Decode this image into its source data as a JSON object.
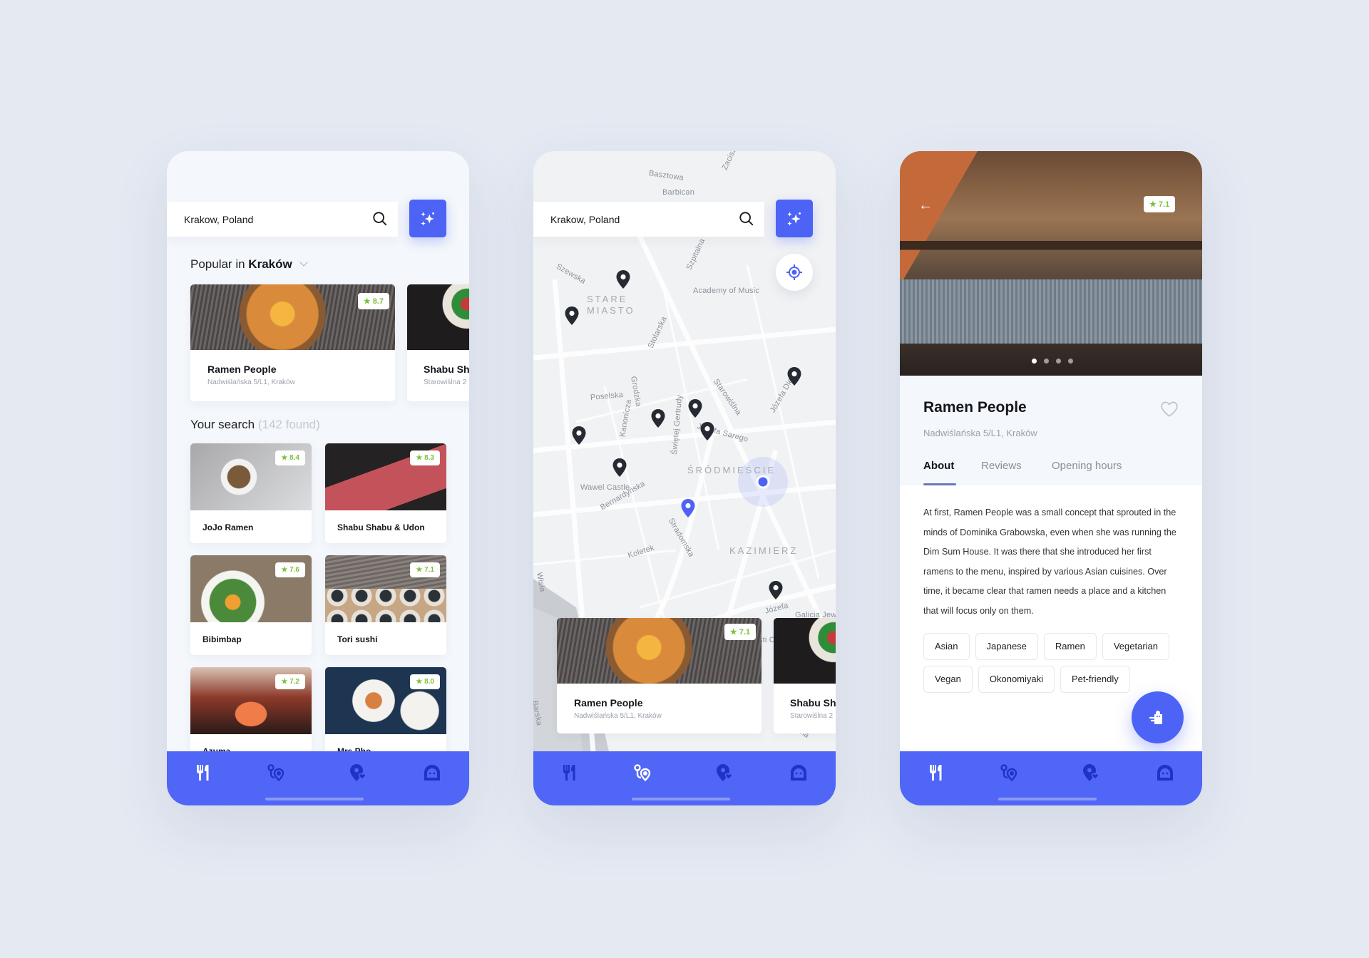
{
  "colors": {
    "primary": "#4d63f5",
    "rating": "#7cc13a",
    "background": "#e4e9f2"
  },
  "search": {
    "value": "Krakow, Poland",
    "icon": "search-icon",
    "filter_icon": "sparkles-icon"
  },
  "explore": {
    "popular_prefix": "Popular in",
    "popular_city": "Kraków",
    "popular": [
      {
        "name": "Ramen People",
        "address": "Nadwiślańska 5/L1, Kraków",
        "rating": "8.7"
      },
      {
        "name": "Shabu Sh",
        "address": "Starowiślna 2"
      }
    ],
    "search_title": "Your search",
    "search_count": "(142 found)",
    "results": [
      {
        "name": "JoJo Ramen",
        "rating": "8.4"
      },
      {
        "name": "Shabu Shabu & Udon",
        "rating": "8.3"
      },
      {
        "name": "Bibimbap",
        "rating": "7.6"
      },
      {
        "name": "Tori sushi",
        "rating": "7.1"
      },
      {
        "name": "Azuma",
        "rating": "7.2"
      },
      {
        "name": "Mrs Pho",
        "rating": "8.0"
      }
    ]
  },
  "map": {
    "labels": [
      "Basztowa",
      "Barbican",
      "Zacisze",
      "Szewska",
      "Szpitalna",
      "Academy of Music",
      "Stolarska",
      "Grodzka",
      "Poselska",
      "Starowiślna",
      "Józefa Dietla",
      "Kanonicza",
      "Józefa Sarego",
      "Świętej Gertrudy",
      "Wawel Castle",
      "Bernardyńska",
      "Stradomska",
      "Koletek",
      "Wisła",
      "Józefa",
      "Galicia Jew",
      "Corpus Christi Church",
      "Barska",
      "Celna"
    ],
    "districts": [
      "STARE MIASTO",
      "ŚRÓDMIEŚCIE",
      "KAZIMIERZ"
    ],
    "card": {
      "name": "Ramen People",
      "address": "Nadwiślańska 5/L1, Kraków",
      "rating": "7.1"
    },
    "card2": {
      "name": "Shabu Sh",
      "address": "Starowiślna 2"
    }
  },
  "detail": {
    "rating": "7.1",
    "name": "Ramen People",
    "address": "Nadwiślańska 5/L1, Kraków",
    "tabs": [
      "About",
      "Reviews",
      "Opening hours"
    ],
    "active_tab": "About",
    "about": "At first, Ramen People was a small concept that sprouted in the minds of Dominika Grabowska, even when she was running the Dim Sum House. It was there that she introduced her first ramens to the menu, inspired by various Asian cuisines. Over time, it became clear that ramen needs a place and a kitchen that will focus only on them.",
    "tags": [
      "Asian",
      "Japanese",
      "Ramen",
      "Vegetarian",
      "Vegan",
      "Okonomiyaki",
      "Pet-friendly"
    ],
    "photo_page": 1,
    "photo_count": 4
  },
  "nav": {
    "items": [
      "restaurants-icon",
      "map-route-icon",
      "favorite-places-icon",
      "profile-icon"
    ]
  }
}
